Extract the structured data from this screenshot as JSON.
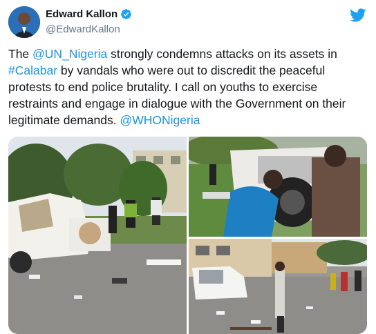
{
  "author": {
    "name": "Edward Kallon",
    "handle": "@EdwardKallon"
  },
  "tweet": {
    "segments": [
      {
        "text": "The ",
        "type": "text"
      },
      {
        "text": "@UN_Nigeria",
        "type": "mention"
      },
      {
        "text": " strongly condemns attacks on its assets in ",
        "type": "text"
      },
      {
        "text": "#Calabar",
        "type": "hashtag"
      },
      {
        "text": " by vandals who were out to discredit the peaceful protests to end police brutality. I call on youths to exercise restraints and engage in dialogue with the Government on their legitimate demands. ",
        "type": "text"
      },
      {
        "text": "@WHONigeria",
        "type": "mention"
      }
    ]
  },
  "icons": {
    "verified": "verified-badge-icon",
    "platform": "twitter-bird-icon"
  },
  "colors": {
    "link": "#1b95e0",
    "verified": "#1da1f2",
    "handle": "#657786"
  }
}
